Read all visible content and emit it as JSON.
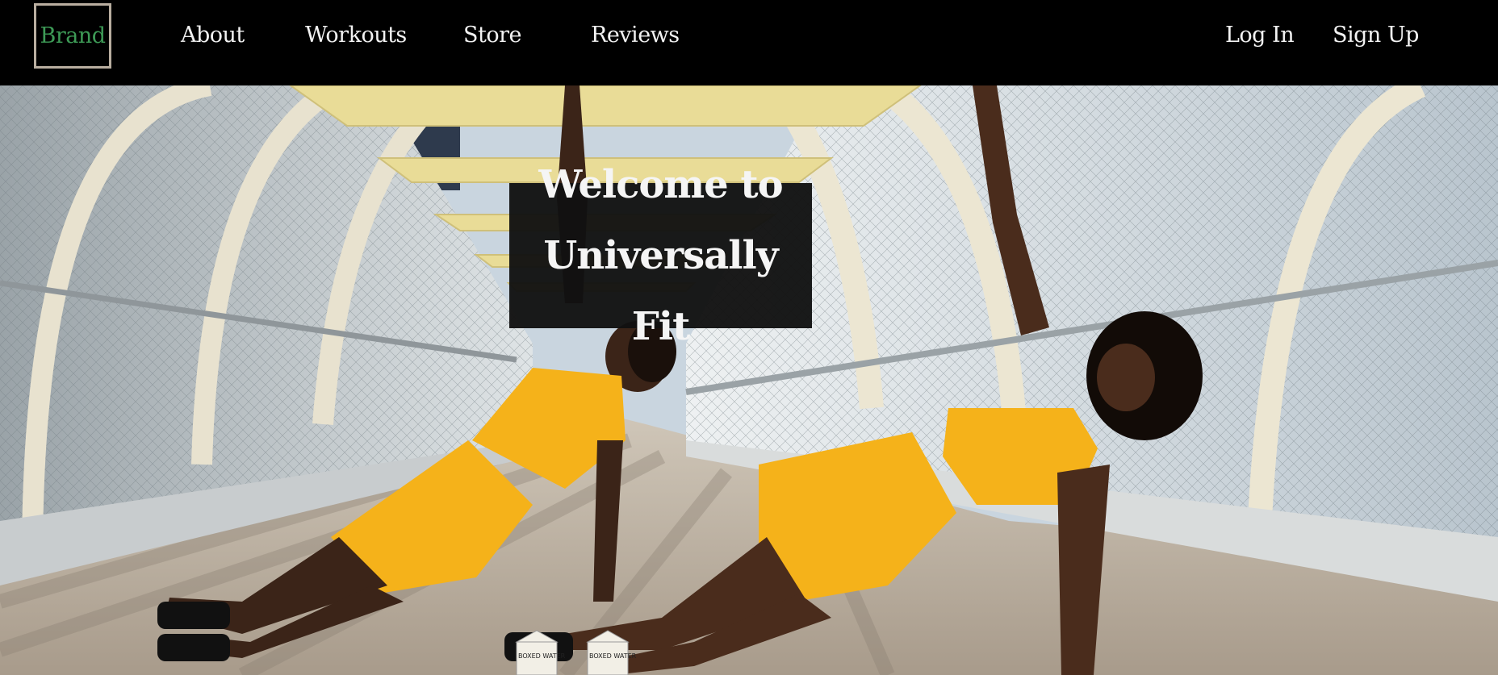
{
  "nav": {
    "brand": "Brand",
    "links": [
      {
        "label": "About"
      },
      {
        "label": "Workouts"
      },
      {
        "label": "Store"
      },
      {
        "label": "Reviews"
      }
    ],
    "auth": {
      "login": "Log In",
      "signup": "Sign Up"
    }
  },
  "hero": {
    "headline_line1": "Welcome to",
    "headline_line2": "Universally Fit",
    "carton_label": "BOXED WATER"
  },
  "colors": {
    "nav_bg": "#000000",
    "brand_text": "#3d9a56",
    "brand_border": "#b9aea0",
    "nav_text": "#f2f2f2",
    "outfit": "#f5b21a",
    "headline_bg": "#111111"
  }
}
